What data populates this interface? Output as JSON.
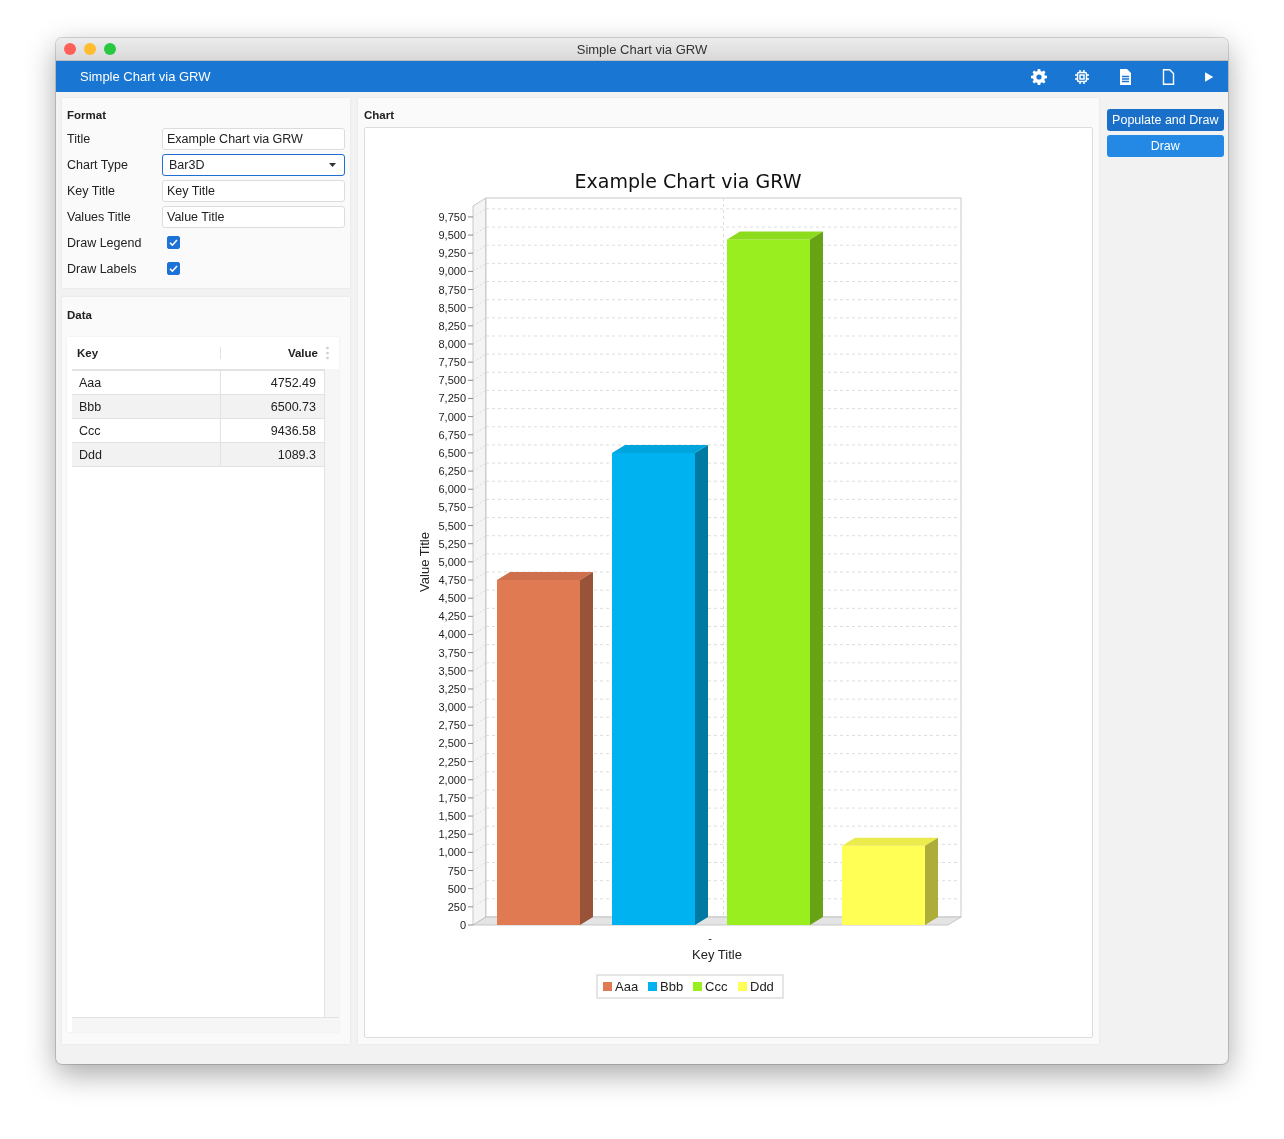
{
  "window": {
    "title": "Simple Chart via GRW"
  },
  "toolbar": {
    "title": "Simple Chart via GRW",
    "buttons": [
      {
        "kind": "settings"
      },
      {
        "kind": "chip"
      },
      {
        "kind": "document"
      },
      {
        "kind": "blank-page"
      },
      {
        "kind": "play"
      }
    ]
  },
  "format": {
    "heading": "Format",
    "fields": [
      {
        "kind": "text",
        "label": "Title",
        "value": "Example Chart via GRW",
        "focused": false
      },
      {
        "kind": "dropdown",
        "label": "Chart Type",
        "value": "Bar3D",
        "focused": true
      },
      {
        "kind": "text",
        "label": "Key Title",
        "value": "Key Title",
        "focused": false
      },
      {
        "kind": "text",
        "label": "Values Title",
        "value": "Value Title",
        "focused": false
      },
      {
        "kind": "checkbox",
        "label": "Draw Legend",
        "checked": true
      },
      {
        "kind": "checkbox",
        "label": "Draw Labels",
        "checked": true
      }
    ]
  },
  "data": {
    "heading": "Data",
    "columns": [
      "Key",
      "Value"
    ],
    "rows": [
      {
        "key": "Aaa",
        "value": "4752.49"
      },
      {
        "key": "Bbb",
        "value": "6500.73"
      },
      {
        "key": "Ccc",
        "value": "9436.58"
      },
      {
        "key": "Ddd",
        "value": "1089.3"
      }
    ]
  },
  "chart": {
    "heading": "Chart",
    "chart_data": {
      "type": "bar",
      "title": "Example Chart via GRW",
      "xlabel": "Key Title",
      "ylabel": "Value Title",
      "categories": [
        "-"
      ],
      "legend": "bottom",
      "series": [
        {
          "name": "Aaa",
          "color": "#e07a52",
          "values": [
            4750
          ]
        },
        {
          "name": "Bbb",
          "color": "#00b3f0",
          "values": [
            6500
          ]
        },
        {
          "name": "Ccc",
          "color": "#99ee1f",
          "values": [
            9440
          ]
        },
        {
          "name": "Ddd",
          "color": "#ffff55",
          "values": [
            1090
          ]
        }
      ],
      "ylim": [
        0,
        9900
      ],
      "yticks": [
        {
          "value": 0,
          "label": "0"
        },
        {
          "value": 250,
          "label": "250"
        },
        {
          "value": 500,
          "label": "500"
        },
        {
          "value": 750,
          "label": "750"
        },
        {
          "value": 1000,
          "label": "1,000"
        },
        {
          "value": 1250,
          "label": "1,250"
        },
        {
          "value": 1500,
          "label": "1,500"
        },
        {
          "value": 1750,
          "label": "1,750"
        },
        {
          "value": 2000,
          "label": "2,000"
        },
        {
          "value": 2250,
          "label": "2,250"
        },
        {
          "value": 2500,
          "label": "2,500"
        },
        {
          "value": 2750,
          "label": "2,750"
        },
        {
          "value": 3000,
          "label": "3,000"
        },
        {
          "value": 3250,
          "label": "3,250"
        },
        {
          "value": 3500,
          "label": "3,500"
        },
        {
          "value": 3750,
          "label": "3,750"
        },
        {
          "value": 4000,
          "label": "4,000"
        },
        {
          "value": 4250,
          "label": "4,250"
        },
        {
          "value": 4500,
          "label": "4,500"
        },
        {
          "value": 4750,
          "label": "4,750"
        },
        {
          "value": 5000,
          "label": "5,000"
        },
        {
          "value": 5250,
          "label": "5,250"
        },
        {
          "value": 5500,
          "label": "5,500"
        },
        {
          "value": 5750,
          "label": "5,750"
        },
        {
          "value": 6000,
          "label": "6,000"
        },
        {
          "value": 6250,
          "label": "6,250"
        },
        {
          "value": 6500,
          "label": "6,500"
        },
        {
          "value": 6750,
          "label": "6,750"
        },
        {
          "value": 7000,
          "label": "7,000"
        },
        {
          "value": 7250,
          "label": "7,250"
        },
        {
          "value": 7500,
          "label": "7,500"
        },
        {
          "value": 7750,
          "label": "7,750"
        },
        {
          "value": 8000,
          "label": "8,000"
        },
        {
          "value": 8250,
          "label": "8,250"
        },
        {
          "value": 8500,
          "label": "8,500"
        },
        {
          "value": 8750,
          "label": "8,750"
        },
        {
          "value": 9000,
          "label": "9,000"
        },
        {
          "value": 9250,
          "label": "9,250"
        },
        {
          "value": 9500,
          "label": "9,500"
        },
        {
          "value": 9750,
          "label": "9,750"
        }
      ]
    }
  },
  "actions": [
    {
      "label": "Populate and Draw",
      "default": true
    },
    {
      "label": "Draw",
      "default": false
    }
  ]
}
